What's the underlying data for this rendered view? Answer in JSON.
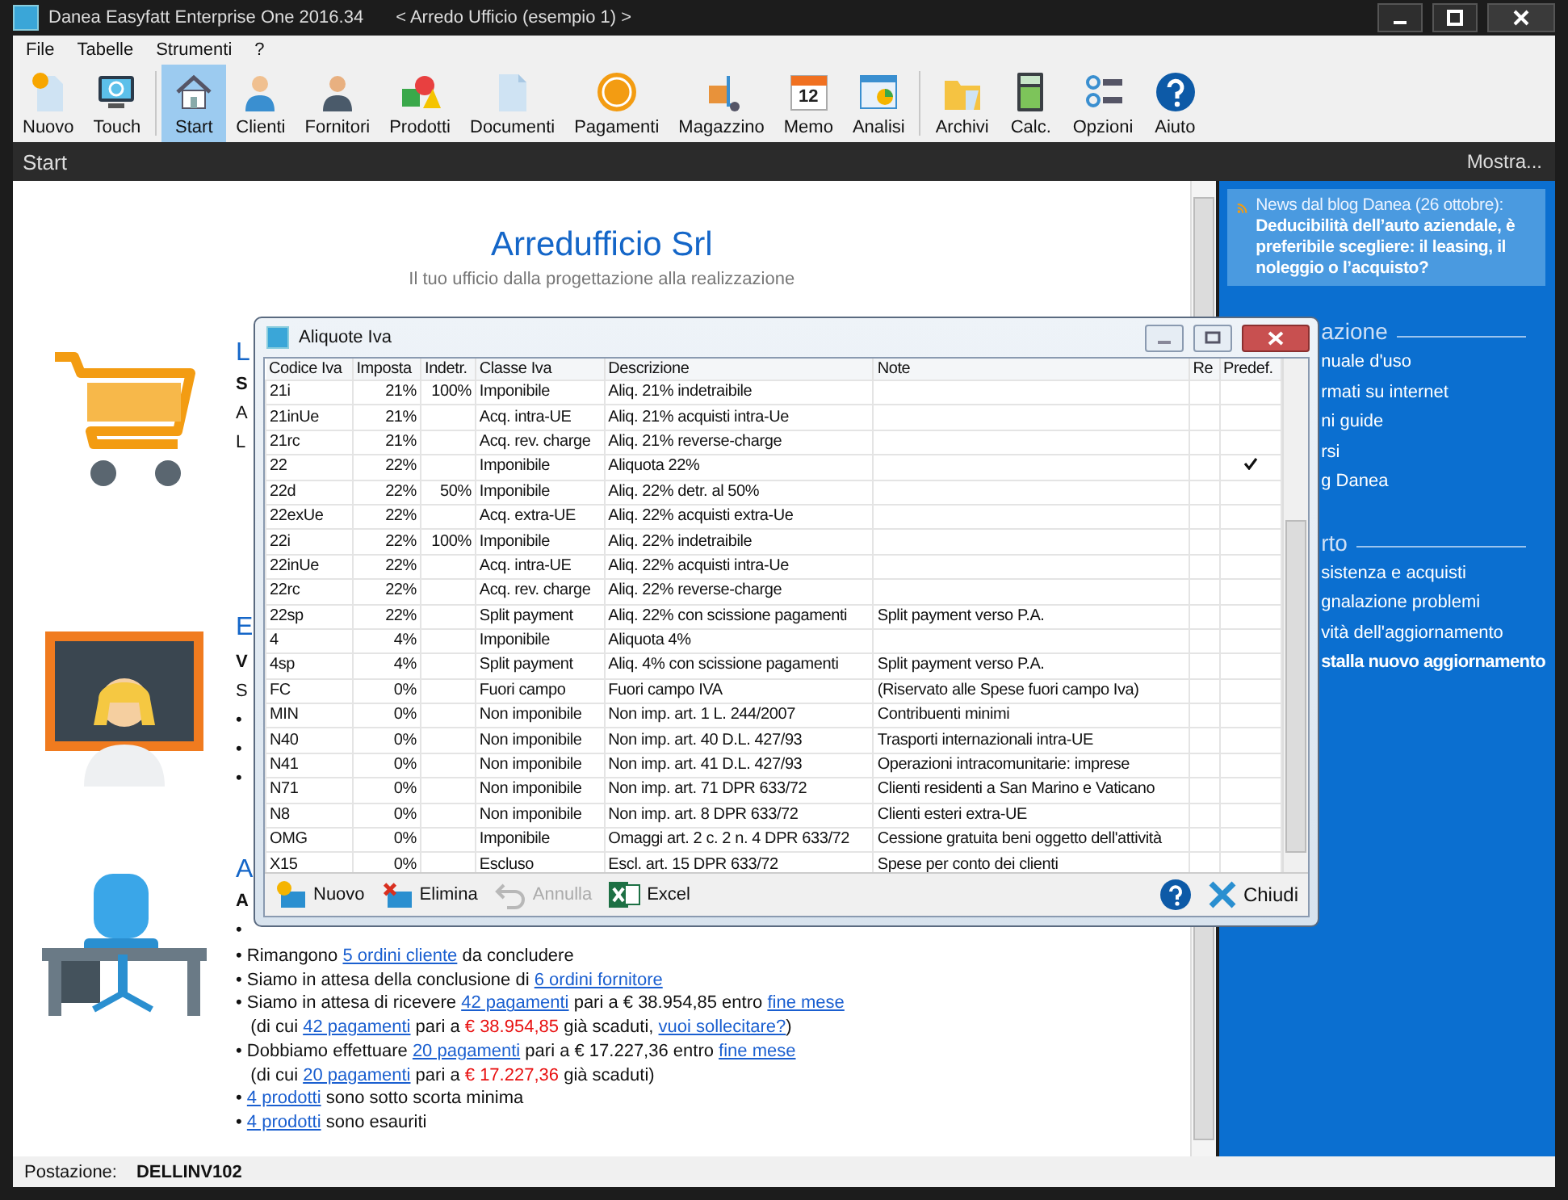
{
  "window": {
    "title": "Danea Easyfatt Enterprise One  2016.34",
    "subtitle": "< Arredo Ufficio (esempio 1) >"
  },
  "menu": [
    "File",
    "Tabelle",
    "Strumenti",
    "?"
  ],
  "toolbar": [
    {
      "label": "Nuovo",
      "selected": false
    },
    {
      "label": "Touch",
      "selected": false
    },
    {
      "label": "Start",
      "selected": true
    },
    {
      "label": "Clienti",
      "selected": false
    },
    {
      "label": "Fornitori",
      "selected": false
    },
    {
      "label": "Prodotti",
      "selected": false
    },
    {
      "label": "Documenti",
      "selected": false
    },
    {
      "label": "Pagamenti",
      "selected": false
    },
    {
      "label": "Magazzino",
      "selected": false
    },
    {
      "label": "Memo",
      "selected": false,
      "badge": "12"
    },
    {
      "label": "Analisi",
      "selected": false
    },
    {
      "label": "Archivi",
      "selected": false
    },
    {
      "label": "Calc.",
      "selected": false
    },
    {
      "label": "Opzioni",
      "selected": false
    },
    {
      "label": "Aiuto",
      "selected": false
    }
  ],
  "page_bar": {
    "title": "Start",
    "action": "Mostra..."
  },
  "company": {
    "name": "Arredufficio Srl",
    "tagline": "Il tuo ufficio dalla progettazione alla realizzazione"
  },
  "sections": [
    {
      "fragments": [
        {
          "kind": "heading",
          "text": "L"
        },
        {
          "kind": "bold",
          "text": "S"
        },
        {
          "kind": "plain",
          "text": "A"
        },
        {
          "kind": "plain",
          "text": "L"
        }
      ]
    },
    {
      "fragments": [
        {
          "kind": "heading",
          "text": "E"
        },
        {
          "kind": "bold",
          "text": "V"
        },
        {
          "kind": "plain",
          "text": "S"
        },
        {
          "kind": "plain",
          "text": "•"
        },
        {
          "kind": "plain",
          "text": "•"
        },
        {
          "kind": "plain",
          "text": "•"
        }
      ]
    },
    {
      "fragments": [
        {
          "kind": "heading",
          "text": "A"
        },
        {
          "kind": "bold",
          "text": "A"
        },
        {
          "kind": "plain",
          "text": "•"
        }
      ],
      "lines": [
        [
          {
            "kind": "text",
            "text": "• Rimangono "
          },
          {
            "kind": "link",
            "text": "5 ordini cliente"
          },
          {
            "kind": "text",
            "text": " da concludere"
          }
        ],
        [
          {
            "kind": "text",
            "text": "• Siamo in attesa della conclusione di "
          },
          {
            "kind": "link",
            "text": "6 ordini fornitore"
          }
        ],
        [
          {
            "kind": "text",
            "text": "• Siamo in attesa di ricevere "
          },
          {
            "kind": "link",
            "text": "42 pagamenti"
          },
          {
            "kind": "text",
            "text": " pari a € 38.954,85 entro "
          },
          {
            "kind": "link",
            "text": "fine mese"
          }
        ],
        [
          {
            "kind": "text",
            "text": "   (di cui "
          },
          {
            "kind": "link",
            "text": "42 pagamenti"
          },
          {
            "kind": "text",
            "text": " pari a "
          },
          {
            "kind": "alert",
            "text": "€ 38.954,85"
          },
          {
            "kind": "text",
            "text": " già scaduti, "
          },
          {
            "kind": "link",
            "text": "vuoi sollecitare?"
          },
          {
            "kind": "text",
            "text": ")"
          }
        ],
        [
          {
            "kind": "text",
            "text": "• Dobbiamo effettuare "
          },
          {
            "kind": "link",
            "text": "20 pagamenti"
          },
          {
            "kind": "text",
            "text": " pari a € 17.227,36 entro "
          },
          {
            "kind": "link",
            "text": "fine mese"
          }
        ],
        [
          {
            "kind": "text",
            "text": "   (di cui "
          },
          {
            "kind": "link",
            "text": "20 pagamenti"
          },
          {
            "kind": "text",
            "text": " pari a "
          },
          {
            "kind": "alert",
            "text": "€ 17.227,36"
          },
          {
            "kind": "text",
            "text": " già scaduti)"
          }
        ],
        [
          {
            "kind": "text",
            "text": "• "
          },
          {
            "kind": "link",
            "text": "4 prodotti"
          },
          {
            "kind": "text",
            "text": " sono sotto scorta minima"
          }
        ],
        [
          {
            "kind": "text",
            "text": "• "
          },
          {
            "kind": "link",
            "text": "4 prodotti"
          },
          {
            "kind": "text",
            "text": " sono esauriti"
          }
        ]
      ]
    }
  ],
  "news": {
    "intro": "News dal blog Danea (26 ottobre):",
    "title": "Deducibilità dell’auto aziendale, è preferibile scegliere: il leasing, il noleggio o l’acquisto?"
  },
  "sidebar": [
    {
      "heading": "azione",
      "items": [
        {
          "label": "nuale d'uso",
          "bold": false
        },
        {
          "label": "rmati su internet",
          "bold": false
        },
        {
          "label": "ni guide",
          "bold": false
        },
        {
          "label": "rsi",
          "bold": false
        },
        {
          "label": "g Danea",
          "bold": false
        }
      ]
    },
    {
      "heading": "rto",
      "items": [
        {
          "label": "sistenza e acquisti",
          "bold": false
        },
        {
          "label": "gnalazione problemi",
          "bold": false
        },
        {
          "label": "vità dell'aggiornamento",
          "bold": false
        },
        {
          "label": "stalla nuovo aggiornamento",
          "bold": true
        }
      ]
    }
  ],
  "status_bar": {
    "label": "Postazione:",
    "value": "DELLINV102"
  },
  "dialog": {
    "title": "Aliquote Iva",
    "columns": [
      "Codice Iva",
      "Imposta",
      "Indetr.",
      "Classe Iva",
      "Descrizione",
      "Note",
      "Re",
      "Predef."
    ],
    "rows": [
      {
        "code": "21i",
        "rate": "21%",
        "indetr": "100%",
        "class": "Imponibile",
        "description": "Aliq. 21% indetraibile",
        "predefined": false
      },
      {
        "code": "21inUe",
        "rate": "21%",
        "class": "Acq. intra-UE",
        "description": "Aliq. 21% acquisti intra-Ue",
        "predefined": false
      },
      {
        "code": "21rc",
        "rate": "21%",
        "class": "Acq. rev. charge",
        "description": "Aliq. 21% reverse-charge",
        "predefined": false
      },
      {
        "code": "22",
        "rate": "22%",
        "class": "Imponibile",
        "description": "Aliquota 22%",
        "predefined": true
      },
      {
        "code": "22d",
        "rate": "22%",
        "indetr": "50%",
        "class": "Imponibile",
        "description": "Aliq. 22% detr. al 50%",
        "predefined": false
      },
      {
        "code": "22exUe",
        "rate": "22%",
        "class": "Acq. extra-UE",
        "description": "Aliq. 22% acquisti extra-Ue",
        "predefined": false
      },
      {
        "code": "22i",
        "rate": "22%",
        "indetr": "100%",
        "class": "Imponibile",
        "description": "Aliq. 22% indetraibile",
        "predefined": false
      },
      {
        "code": "22inUe",
        "rate": "22%",
        "class": "Acq. intra-UE",
        "description": "Aliq. 22% acquisti intra-Ue",
        "predefined": false
      },
      {
        "code": "22rc",
        "rate": "22%",
        "class": "Acq. rev. charge",
        "description": "Aliq. 22% reverse-charge",
        "predefined": false
      },
      {
        "code": "22sp",
        "rate": "22%",
        "class": "Split payment",
        "description": "Aliq. 22% con scissione pagamenti",
        "note": "Split payment verso P.A.",
        "predefined": false
      },
      {
        "code": "4",
        "rate": "4%",
        "class": "Imponibile",
        "description": "Aliquota 4%",
        "predefined": false
      },
      {
        "code": "4sp",
        "rate": "4%",
        "class": "Split payment",
        "description": "Aliq. 4% con scissione pagamenti",
        "note": "Split payment verso P.A.",
        "predefined": false
      },
      {
        "code": "FC",
        "rate": "0%",
        "class": "Fuori campo",
        "description": "Fuori campo IVA",
        "note": "(Riservato alle Spese fuori campo Iva)",
        "predefined": false
      },
      {
        "code": "MIN",
        "rate": "0%",
        "class": "Non imponibile",
        "description": "Non imp. art. 1 L. 244/2007",
        "note": "Contribuenti minimi",
        "predefined": false
      },
      {
        "code": "N40",
        "rate": "0%",
        "class": "Non imponibile",
        "description": "Non imp. art. 40 D.L. 427/93",
        "note": "Trasporti internazionali intra-UE",
        "predefined": false
      },
      {
        "code": "N41",
        "rate": "0%",
        "class": "Non imponibile",
        "description": "Non imp. art. 41 D.L. 427/93",
        "note": "Operazioni intracomunitarie: imprese",
        "predefined": false
      },
      {
        "code": "N71",
        "rate": "0%",
        "class": "Non imponibile",
        "description": "Non imp. art. 71 DPR 633/72",
        "note": "Clienti residenti a San Marino e Vaticano",
        "predefined": false
      },
      {
        "code": "N8",
        "rate": "0%",
        "class": "Non imponibile",
        "description": "Non imp. art. 8 DPR 633/72",
        "note": "Clienti esteri extra-UE",
        "predefined": false
      },
      {
        "code": "OMG",
        "rate": "0%",
        "class": "Imponibile",
        "description": "Omaggi art. 2 c. 2 n. 4 DPR 633/72",
        "note": "Cessione gratuita beni oggetto dell'attività",
        "predefined": false
      },
      {
        "code": "X15",
        "rate": "0%",
        "class": "Escluso",
        "description": "Escl. art. 15 DPR 633/72",
        "note": "Spese per conto dei clienti",
        "predefined": false
      }
    ],
    "actions": [
      {
        "label": "Nuovo",
        "disabled": false
      },
      {
        "label": "Elimina",
        "disabled": false
      },
      {
        "label": "Annulla",
        "disabled": true
      },
      {
        "label": "Excel",
        "disabled": false
      }
    ],
    "close": "Chiudi"
  }
}
